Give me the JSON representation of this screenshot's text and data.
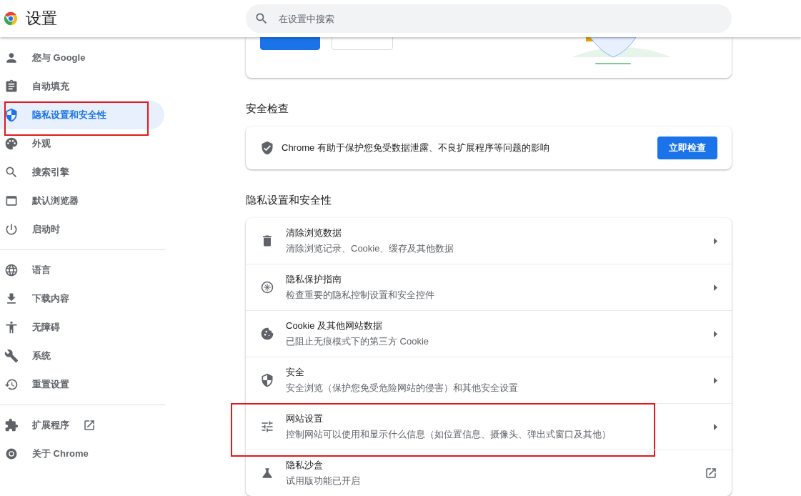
{
  "header": {
    "title": "设置",
    "search": {
      "placeholder": "在设置中搜索"
    }
  },
  "sidebar": {
    "groups": [
      {
        "items": [
          {
            "label": "您与 Google",
            "selected": false,
            "highlighted": false
          },
          {
            "label": "自动填充",
            "selected": false,
            "highlighted": false
          },
          {
            "label": "隐私设置和安全性",
            "selected": true,
            "highlighted": true
          },
          {
            "label": "外观",
            "selected": false,
            "highlighted": false
          },
          {
            "label": "搜索引擎",
            "selected": false,
            "highlighted": false
          },
          {
            "label": "默认浏览器",
            "selected": false,
            "highlighted": false
          },
          {
            "label": "启动时",
            "selected": false,
            "highlighted": false
          }
        ]
      },
      {
        "items": [
          {
            "label": "语言",
            "selected": false,
            "highlighted": false
          },
          {
            "label": "下载内容",
            "selected": false,
            "highlighted": false
          },
          {
            "label": "无障碍",
            "selected": false,
            "highlighted": false
          },
          {
            "label": "系统",
            "selected": false,
            "highlighted": false
          },
          {
            "label": "重置设置",
            "selected": false,
            "highlighted": false
          }
        ]
      },
      {
        "items": [
          {
            "label": "扩展程序",
            "selected": false,
            "highlighted": false,
            "external": true
          },
          {
            "label": "关于 Chrome",
            "selected": false,
            "highlighted": false,
            "external": false
          }
        ]
      }
    ]
  },
  "safety_check": {
    "heading": "安全检查",
    "text": "Chrome 有助于保护您免受数据泄露、不良扩展程序等问题的影响",
    "button": "立即检查"
  },
  "privacy": {
    "heading": "隐私设置和安全性",
    "rows": [
      {
        "kind": "arrow",
        "title": "清除浏览数据",
        "subtitle": "清除浏览记录、Cookie、缓存及其他数据",
        "highlighted": false
      },
      {
        "kind": "arrow",
        "title": "隐私保护指南",
        "subtitle": "检查重要的隐私控制设置和安全控件",
        "highlighted": false
      },
      {
        "kind": "arrow",
        "title": "Cookie 及其他网站数据",
        "subtitle": "已阻止无痕模式下的第三方 Cookie",
        "highlighted": false
      },
      {
        "kind": "arrow",
        "title": "安全",
        "subtitle": "安全浏览（保护您免受危险网站的侵害）和其他安全设置",
        "highlighted": false
      },
      {
        "kind": "arrow",
        "title": "网站设置",
        "subtitle": "控制网站可以使用和显示什么信息（如位置信息、摄像头、弹出式窗口及其他）",
        "highlighted": true
      },
      {
        "kind": "external",
        "title": "隐私沙盒",
        "subtitle": "试用版功能已开启",
        "highlighted": false
      }
    ]
  }
}
